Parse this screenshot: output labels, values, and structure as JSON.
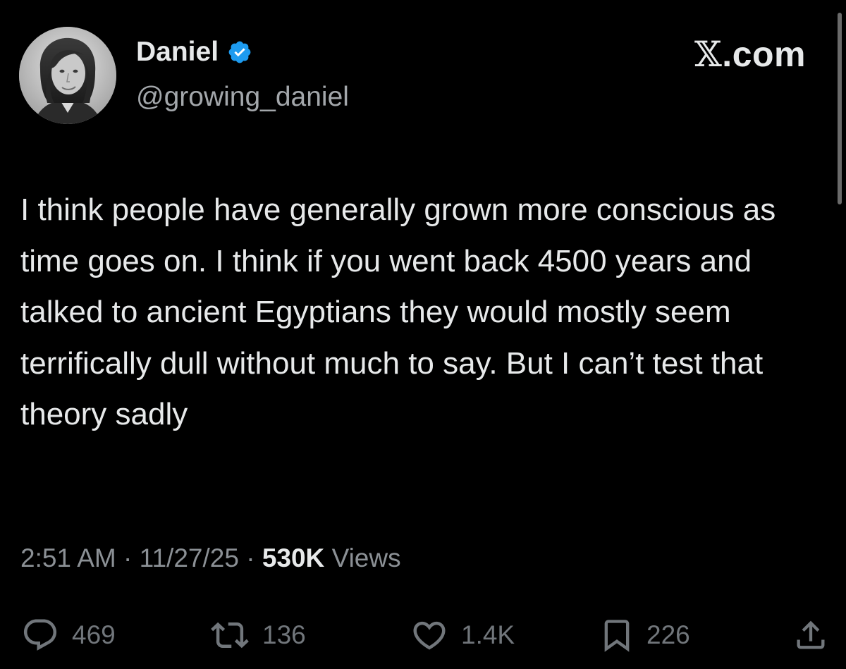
{
  "author": {
    "display_name": "Daniel",
    "handle": "@growing_daniel",
    "verified": true
  },
  "brand": {
    "glyph": "𝕏",
    "suffix": ".com"
  },
  "tweet": {
    "text": "I think people have generally grown more conscious as time goes on. I think if you went back 4500 years and talked to ancient Egyptians they would mostly seem terrifically dull without much to say. But I can’t test that theory sadly"
  },
  "meta": {
    "time": "2:51 AM",
    "separator": " · ",
    "date": "11/27/25",
    "views_count": "530K",
    "views_label": "Views"
  },
  "actions": {
    "replies": "469",
    "reposts": "136",
    "likes": "1.4K",
    "bookmarks": "226"
  },
  "icons": {
    "verified": "verified-badge-icon",
    "reply": "speech-bubble-icon",
    "repost": "repost-arrows-icon",
    "like": "heart-icon",
    "bookmark": "bookmark-icon",
    "share": "share-upload-icon"
  },
  "colors": {
    "background": "#000000",
    "text_primary": "#e7e9ea",
    "text_secondary": "#71767b",
    "verified_blue": "#1d9bf0"
  }
}
